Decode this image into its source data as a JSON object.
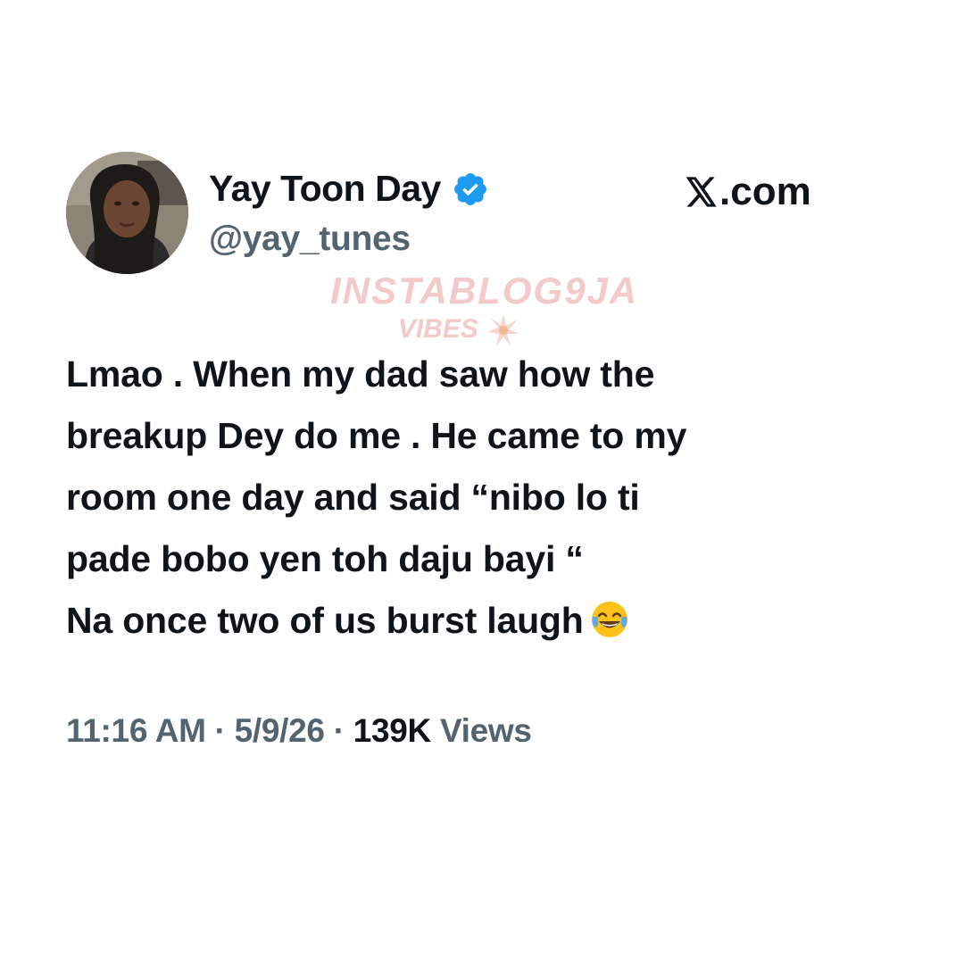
{
  "profile": {
    "display_name": "Yay Toon Day",
    "handle": "@yay_tunes",
    "verified": true,
    "verified_color": "#1d9bf0"
  },
  "brand": {
    "label": ".com"
  },
  "watermark": {
    "main": "INSTABLOG9JA",
    "sub": "VIBES",
    "color": "#f4c9c9"
  },
  "tweet": {
    "lines": [
      "Lmao . When my dad saw how the",
      "breakup Dey do me . He came to my",
      "room one day and said “nibo lo ti",
      "pade bobo yen toh daju bayi “",
      "Na once two of us burst laugh"
    ],
    "emoji": "face-with-tears-of-joy"
  },
  "meta": {
    "time": "11:16 AM",
    "date": "5/9/26",
    "separator": "·",
    "views_count": "139K",
    "views_label": "Views"
  }
}
